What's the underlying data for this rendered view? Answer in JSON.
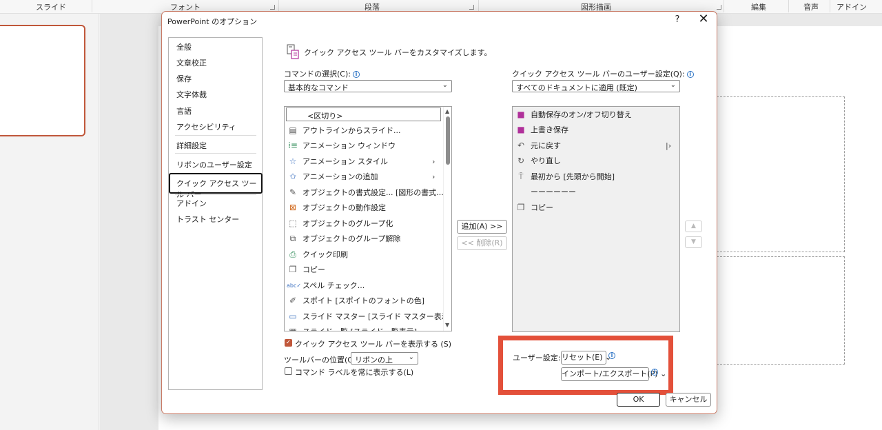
{
  "ribbon": {
    "groups": [
      "スライド",
      "フォント",
      "段落",
      "図形描画",
      "編集",
      "音声",
      "アドイン"
    ]
  },
  "dialog": {
    "title": "PowerPoint のオプション",
    "help": "?",
    "close": "✕",
    "nav": [
      "全般",
      "文章校正",
      "保存",
      "文字体裁",
      "言語",
      "アクセシビリティ",
      "詳細設定",
      "リボンのユーザー設定",
      "クイック アクセス ツール バー",
      "アドイン",
      "トラスト センター"
    ],
    "nav_selected": "クイック アクセス ツール バー",
    "header": "クイック アクセス ツール バーをカスタマイズします。",
    "commands_label": "コマンドの選択(C):",
    "commands_value": "基本的なコマンド",
    "qat_label": "クイック アクセス ツール バーのユーザー設定(Q):",
    "qat_value": "すべてのドキュメントに適用 (既定)",
    "commands": [
      {
        "icon": "separator",
        "label": "<区切り>"
      },
      {
        "icon": "outline-icon",
        "label": "アウトラインからスライド..."
      },
      {
        "icon": "animation-pane-icon",
        "label": "アニメーション ウィンドウ"
      },
      {
        "icon": "animation-style-icon",
        "label": "アニメーション スタイル",
        "submenu": "›"
      },
      {
        "icon": "add-animation-icon",
        "label": "アニメーションの追加",
        "submenu": "›"
      },
      {
        "icon": "format-object-icon",
        "label": "オブジェクトの書式設定... [図形の書式..."
      },
      {
        "icon": "object-action-icon",
        "label": "オブジェクトの動作設定"
      },
      {
        "icon": "group-icon",
        "label": "オブジェクトのグループ化"
      },
      {
        "icon": "ungroup-icon",
        "label": "オブジェクトのグループ解除"
      },
      {
        "icon": "quick-print-icon",
        "label": "クイック印刷"
      },
      {
        "icon": "copy-icon",
        "label": "コピー"
      },
      {
        "icon": "spelling-icon",
        "label": "スペル チェック..."
      },
      {
        "icon": "eyedropper-icon",
        "label": "スポイト [スポイトのフォントの色]"
      },
      {
        "icon": "slide-master-icon",
        "label": "スライド マスター [スライド マスター表示]"
      },
      {
        "icon": "slide-sorter-icon",
        "label": "スライド一覧 [スライド一覧表示]"
      }
    ],
    "qat_items": [
      {
        "icon": "autosave-icon",
        "label": "自動保存のオン/オフ切り替え"
      },
      {
        "icon": "save-icon",
        "label": "上書き保存"
      },
      {
        "icon": "undo-icon",
        "label": "元に戻す",
        "submenu": "|›"
      },
      {
        "icon": "redo-icon",
        "label": "やり直し"
      },
      {
        "icon": "start-from-beginning-icon",
        "label": "最初から [先頭から開始]"
      },
      {
        "icon": "separator-line",
        "label": "ーーーーーー"
      },
      {
        "icon": "copy-icon",
        "label": "コピー"
      }
    ],
    "add_button": "追加(A) >>",
    "remove_button": "<< 削除(R)",
    "move_up": "▲",
    "move_down": "▼",
    "show_qat_label": "クイック アクセス ツール バーを表示する (S)",
    "toolbar_position_label": "ツールバーの位置(O)",
    "toolbar_position_value": "リボンの上",
    "always_show_labels": "コマンド ラベルを常に表示する(L)",
    "user_settings_label": "ユーザー設定:",
    "reset_button": "リセット(E)",
    "import_export_button": "インポート/エクスポート(P)",
    "ok": "OK",
    "cancel": "キャンセル"
  },
  "colors": {
    "accent": "#c0573a",
    "highlight": "#e3503a",
    "magenta_icon": "#b0309a"
  }
}
